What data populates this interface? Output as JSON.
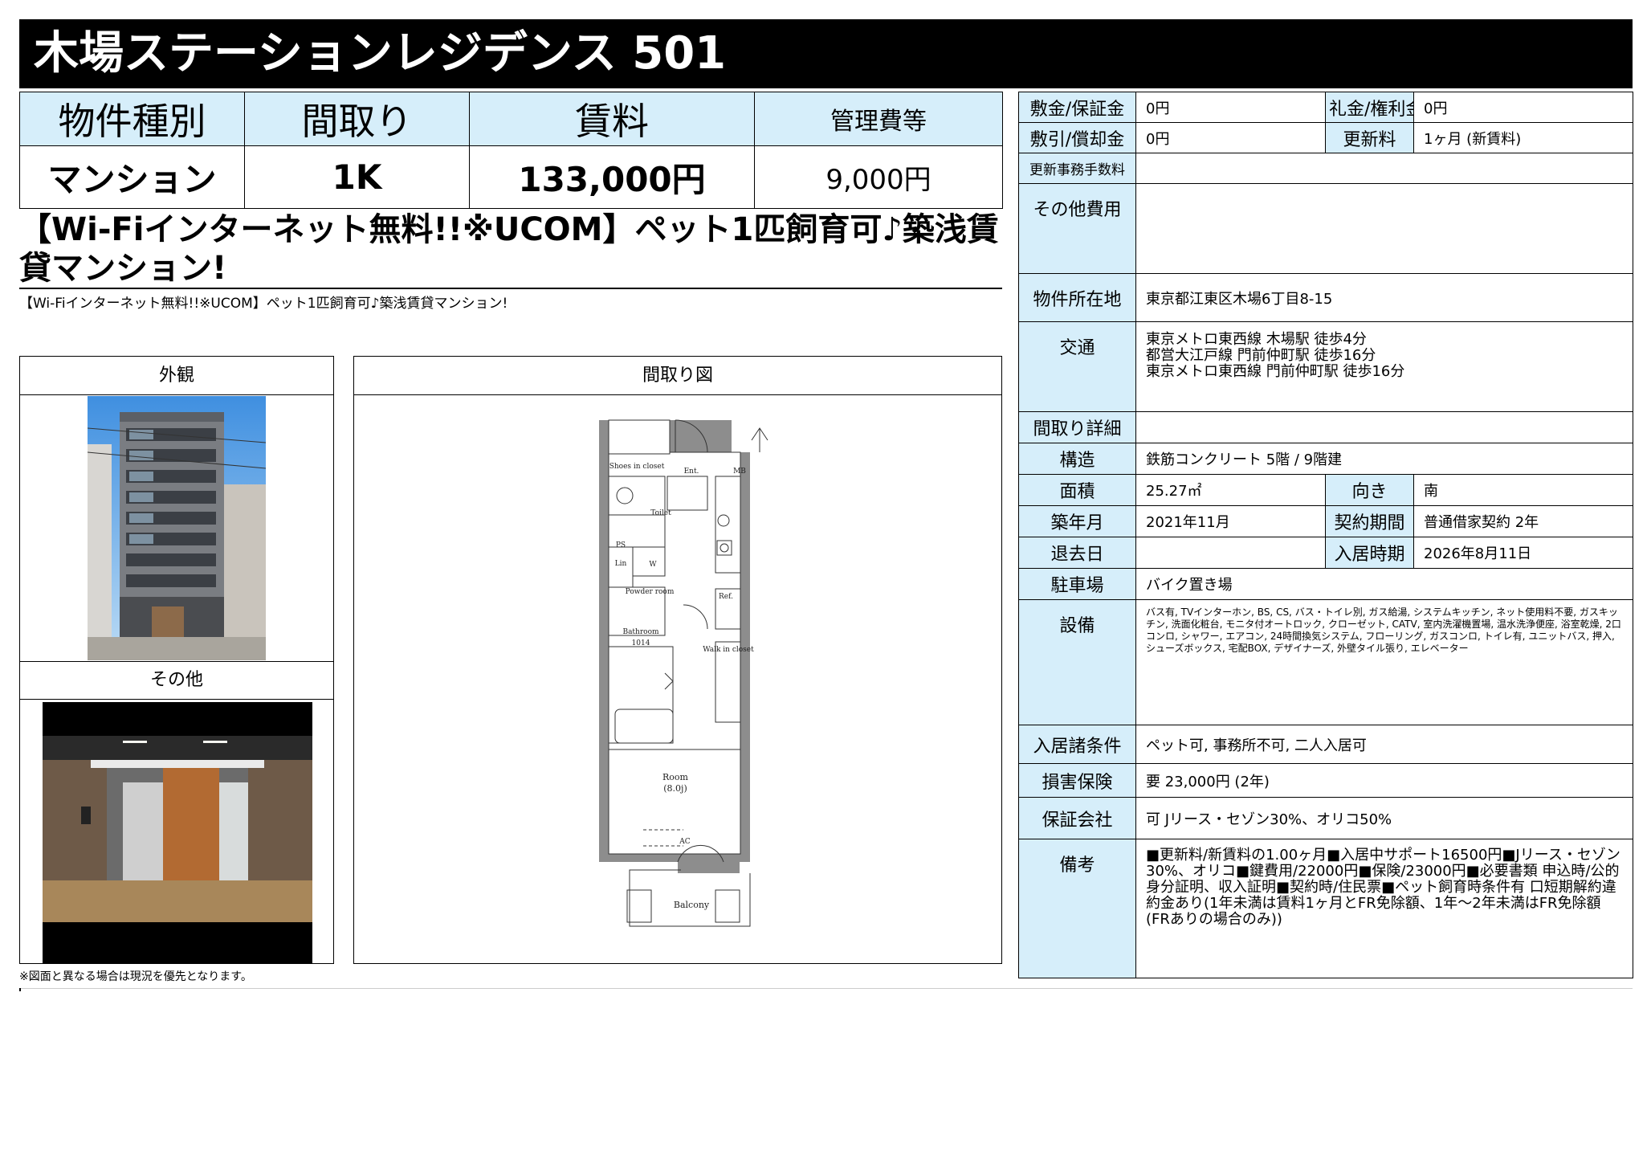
{
  "title": "木場ステーションレジデンス 501",
  "summary": {
    "headers": [
      "物件種別",
      "間取り",
      "賃料",
      "管理費等"
    ],
    "values": [
      "マンション",
      "1K",
      "133,000円",
      "9,000円"
    ]
  },
  "catch_copy": "【Wi-Fiインターネット無料!!※UCOM】ペット1匹飼育可♪築浅賃貸マンション!",
  "sub_copy": "【Wi-Fiインターネット無料!!※UCOM】ペット1匹飼育可♪築浅賃貸マンション!",
  "photos": {
    "exterior_label": "外観",
    "other_label": "その他",
    "floorplan_label": "間取り図"
  },
  "floorplan": {
    "shoes": "Shoes in closet",
    "ent": "Ent.",
    "mb": "MB",
    "toilet": "Toilet",
    "ps": "PS",
    "lin": "Lin",
    "w": "W",
    "powder": "Powder room",
    "ref": "Ref.",
    "bath": "Bathroom",
    "bath_size": "1014",
    "walk": "Walk in closet",
    "room": "Room",
    "room_size": "(8.0j)",
    "ac": "AC",
    "balcony": "Balcony"
  },
  "note": "※図面と異なる場合は現況を優先となります。",
  "details": {
    "deposit_label": "敷金/保証金",
    "deposit": "0円",
    "key_label": "礼金/権利金",
    "key": "0円",
    "amort_label": "敷引/償却金",
    "amort": "0円",
    "renewal_label": "更新料",
    "renewal": "1ヶ月 (新賃料)",
    "renewal_fee_label": "更新事務手数料",
    "renewal_fee": "",
    "other_cost_label": "その他費用",
    "other_cost": "",
    "address_label": "物件所在地",
    "address": "東京都江東区木場6丁目8-15",
    "access_label": "交通",
    "access": [
      "東京メトロ東西線 木場駅 徒歩4分",
      "都営大江戸線 門前仲町駅 徒歩16分",
      "東京メトロ東西線 門前仲町駅 徒歩16分"
    ],
    "layout_detail_label": "間取り詳細",
    "layout_detail": "",
    "structure_label": "構造",
    "structure": "鉄筋コンクリート 5階 / 9階建",
    "area_label": "面積",
    "area": "25.27㎡",
    "direction_label": "向き",
    "direction": "南",
    "built_label": "築年月",
    "built": "2021年11月",
    "contract_label": "契約期間",
    "contract": "普通借家契約 2年",
    "move_out_label": "退去日",
    "move_out": "",
    "move_in_label": "入居時期",
    "move_in": "2026年8月11日",
    "parking_label": "駐車場",
    "parking": "バイク置き場",
    "equipment_label": "設備",
    "equipment": "バス有, TVインターホン, BS, CS, バス・トイレ別, ガス給湯, システムキッチン, ネット使用料不要, ガスキッチン, 洗面化粧台, モニタ付オートロック, クローゼット, CATV, 室内洗濯機置場, 温水洗浄便座, 浴室乾燥, 2口コンロ, シャワー, エアコン, 24時間換気システム, フローリング, ガスコンロ, トイレ有, ユニットバス, 押入, シューズボックス, 宅配BOX, デザイナーズ, 外壁タイル張り, エレベーター",
    "conditions_label": "入居諸条件",
    "conditions": "ペット可, 事務所不可, 二人入居可",
    "insurance_label": "損害保険",
    "insurance": "要 23,000円 (2年)",
    "guarantor_label": "保証会社",
    "guarantor": "可 Jリース・セゾン30%、オリコ50%",
    "remarks_label": "備考",
    "remarks": "■更新料/新賃料の1.00ヶ月■入居中サポート16500円■Jリース・セゾン30%、オリコ■鍵費用/22000円■保険/23000円■必要書類 申込時/公的身分証明、収入証明■契約時/住民票■ペット飼育時条件有 口短期解約違約金あり(1年未満は賃料1ヶ月とFR免除額、1年〜2年未満はFR免除額(FRありの場合のみ))"
  }
}
